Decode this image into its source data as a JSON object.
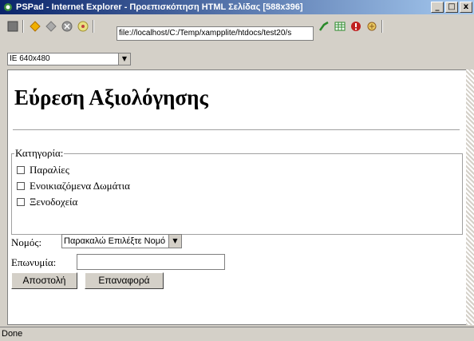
{
  "window": {
    "title": "PSPad - Internet Explorer - Προεπισκόπηση HTML Σελίδας  [588x396]",
    "buttons": [
      "_",
      "□",
      "x"
    ]
  },
  "toolbar": {
    "address": "file://localhost/C:/Temp/xampplite/htdocs/test20/s",
    "icons": [
      "stop-icon",
      "back-icon",
      "forward-icon",
      "refresh-icon",
      "home-icon",
      "go-icon",
      "grid-icon",
      "warning-icon",
      "hand-icon"
    ]
  },
  "resolution": {
    "value": "IE 640x480"
  },
  "page": {
    "heading": "Εύρεση Αξιολόγησης",
    "category_legend": "Κατηγορία:",
    "categories": [
      "Παραλίες",
      "Ενοικιαζόμενα Δωμάτια",
      "Ξενοδοχεία"
    ],
    "prefecture_label": "Νομός:",
    "prefecture_selected": "Παρακαλώ Επιλέξτε Νομό",
    "name_label": "Επωνυμία:",
    "name_value": "",
    "submit_label": "Αποστολή",
    "reset_label": "Επαναφορά"
  },
  "status": {
    "text": "Done"
  },
  "colors": {
    "title_start": "#0a246a",
    "title_end": "#a6caf0",
    "chrome": "#d4d0c8"
  }
}
